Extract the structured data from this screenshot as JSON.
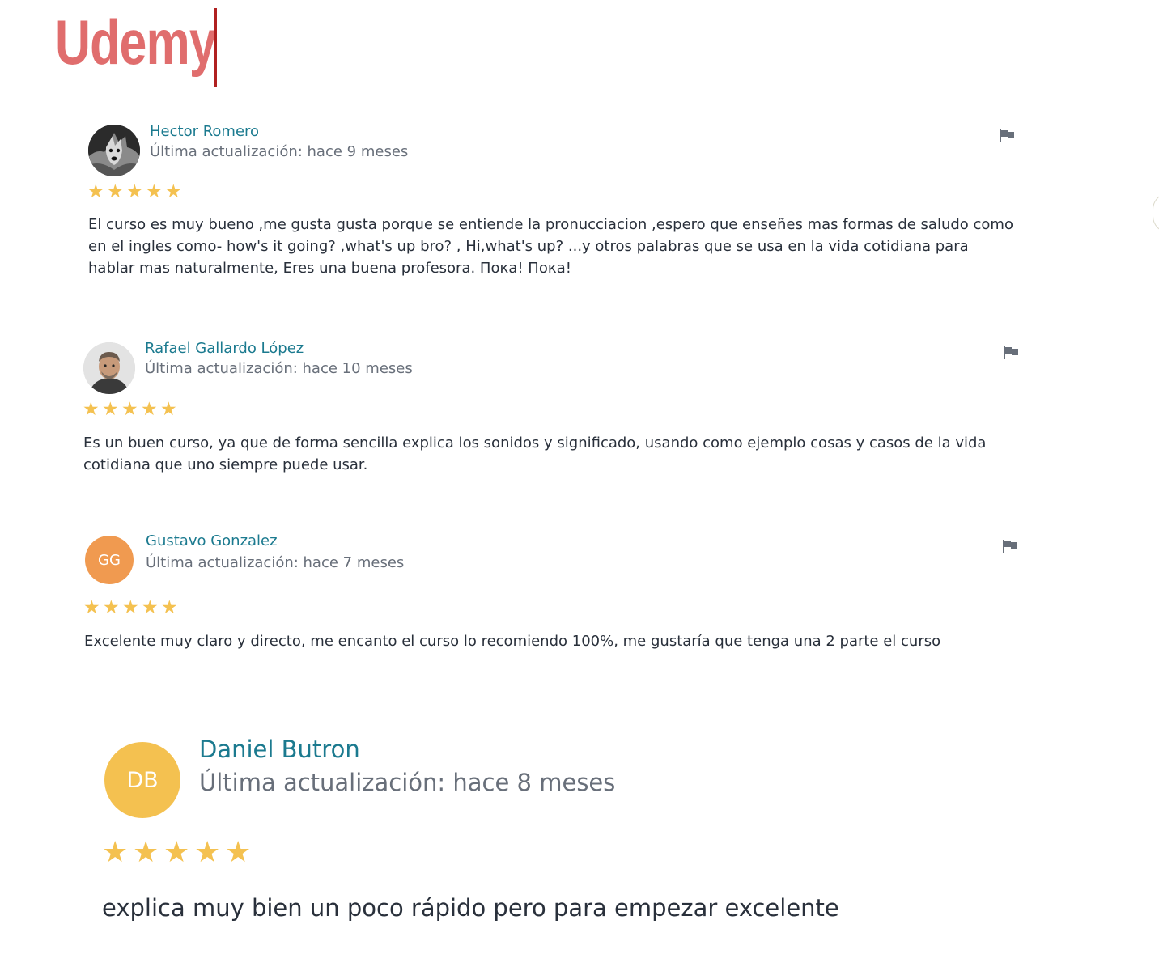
{
  "brand": {
    "logo_text": "Udemy",
    "color": "#e06d6d"
  },
  "colors": {
    "name": "#1b7a8f",
    "date": "#686f7a",
    "star": "#f4c150",
    "text": "#29303b",
    "flag": "#686f7a"
  },
  "reviews": [
    {
      "name": "Hector Romero",
      "date": "Última actualización: hace 9 meses",
      "rating": 5,
      "avatar_type": "photo",
      "avatar_icon": "wolf-photo",
      "text": "El curso es muy bueno ,me gusta gusta porque se entiende la pronucciacion ,espero que enseñes mas formas de saludo como en el ingles como- how's it going? ,what's up bro? , Hi,what's up? ...y otros palabras que se usa en la vida cotidiana para hablar mas naturalmente, Eres una buena profesora. Пока! Пока!"
    },
    {
      "name": "Rafael Gallardo López",
      "date": "Última actualización: hace 10 meses",
      "rating": 5,
      "avatar_type": "photo",
      "avatar_icon": "person-photo",
      "text": "Es un buen curso, ya que de forma sencilla explica los sonidos y significado, usando como ejemplo cosas y casos de la vida cotidiana que uno siempre puede usar."
    },
    {
      "name": "Gustavo Gonzalez",
      "date": "Última actualización: hace 7 meses",
      "rating": 5,
      "avatar_type": "initials",
      "initials": "GG",
      "avatar_color": "#f09a50",
      "text": "Excelente muy claro y directo, me encanto el curso lo recomiendo 100%, me gustaría que tenga una 2 parte el curso"
    },
    {
      "name": "Daniel Butron",
      "date": "Última actualización: hace 8 meses",
      "rating": 5,
      "avatar_type": "initials",
      "initials": "DB",
      "avatar_color": "#f4c150",
      "text": "explica muy bien un poco rápido pero para empezar excelente"
    }
  ]
}
